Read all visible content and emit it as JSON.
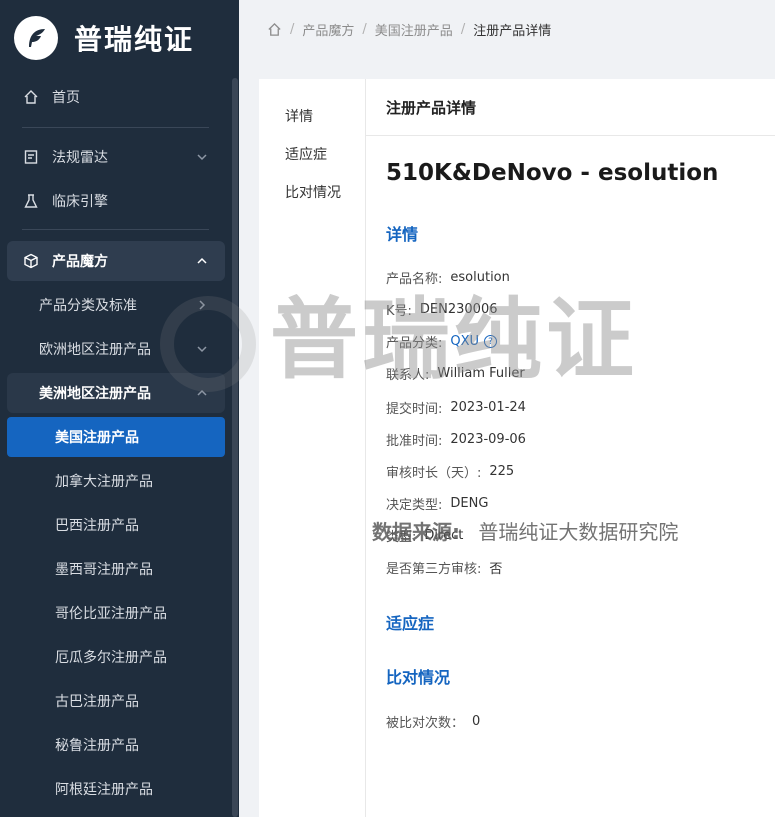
{
  "brand": {
    "name": "普瑞纯证"
  },
  "sidebar": {
    "items": [
      {
        "label": "首页"
      },
      {
        "label": "法规雷达"
      },
      {
        "label": "临床引擎"
      },
      {
        "label": "产品魔方"
      },
      {
        "label": "产品分类及标准"
      },
      {
        "label": "欧洲地区注册产品"
      },
      {
        "label": "美洲地区注册产品"
      },
      {
        "label": "美国注册产品"
      },
      {
        "label": "加拿大注册产品"
      },
      {
        "label": "巴西注册产品"
      },
      {
        "label": "墨西哥注册产品"
      },
      {
        "label": "哥伦比亚注册产品"
      },
      {
        "label": "厄瓜多尔注册产品"
      },
      {
        "label": "古巴注册产品"
      },
      {
        "label": "秘鲁注册产品"
      },
      {
        "label": "阿根廷注册产品"
      }
    ]
  },
  "breadcrumb": {
    "items": [
      "产品魔方",
      "美国注册产品",
      "注册产品详情"
    ]
  },
  "tabs": [
    "详情",
    "适应症",
    "比对情况"
  ],
  "card": {
    "header": "注册产品详情"
  },
  "product": {
    "title": "510K&DeNovo - esolution",
    "sections": {
      "details": "详情",
      "indication": "适应症",
      "comparison": "比对情况"
    },
    "fields": {
      "name": {
        "label": "产品名称:",
        "value": "esolution"
      },
      "k_number": {
        "label": "K号:",
        "value": "DEN230006"
      },
      "classification": {
        "label": "产品分类:",
        "value": "QXU"
      },
      "contact": {
        "label": "联系人:",
        "value": "William Fuller"
      },
      "submit_date": {
        "label": "提交时间:",
        "value": "2023-01-24"
      },
      "approval_date": {
        "label": "批准时间:",
        "value": "2023-09-06"
      },
      "review_days": {
        "label": "审核时长（天）:",
        "value": "225"
      },
      "decision_type": {
        "label": "决定类型:",
        "value": "DENG"
      },
      "type": {
        "label": "类型:",
        "value": "Direct"
      },
      "third_party": {
        "label": "是否第三方审核:",
        "value": "否"
      },
      "compare_count": {
        "label": "被比对次数：",
        "value": "0"
      }
    }
  },
  "watermark": {
    "main": "普瑞纯证",
    "source_label": "数据来源:",
    "source_value": "普瑞纯证大数据研究院"
  },
  "colors": {
    "sidebar_bg": "#1f2d3d",
    "accent": "#1565c0"
  }
}
